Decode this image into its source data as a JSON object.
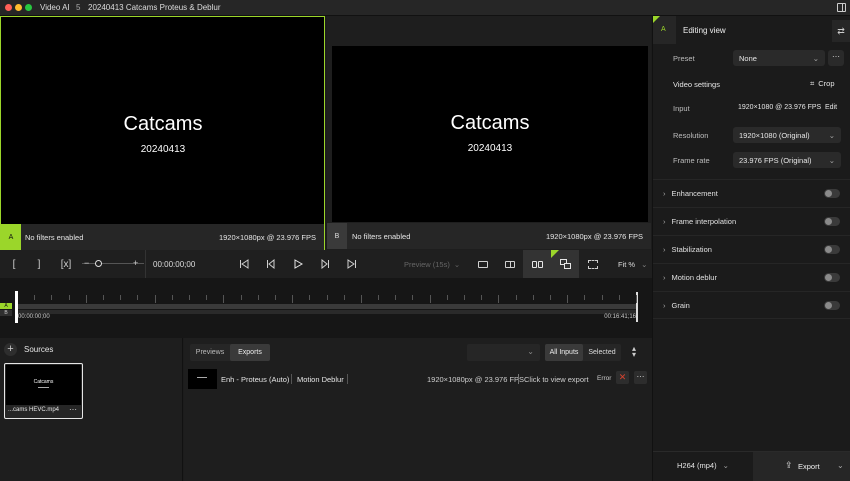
{
  "titlebar": {
    "app_name": "Video AI",
    "app_badge": "5",
    "project_title": "20240413  Catcams Proteus & Deblur"
  },
  "viewers": {
    "a": {
      "badge": "A",
      "title": "Catcams",
      "date": "20240413",
      "filters": "No filters enabled",
      "format": "1920×1080px @ 23.976 FPS"
    },
    "b": {
      "badge": "B",
      "title": "Catcams",
      "date": "20240413",
      "filters": "No filters enabled",
      "format": "1920×1080px @ 23.976 FPS"
    }
  },
  "transport": {
    "timecode": "00:00:00;00",
    "preview_label": "Preview (15s)",
    "zoom_label": "Fit %"
  },
  "timeline": {
    "start_time": "00:00:00;00",
    "end_time": "00:16:41;16",
    "track_a": "A",
    "track_b": "B"
  },
  "sources": {
    "title": "Sources",
    "items": [
      {
        "thumb_title": "Catcams",
        "filename": "...cams HEVC.mp4"
      }
    ]
  },
  "exports": {
    "tabs": [
      {
        "label": "Previews",
        "active": false
      },
      {
        "label": "Exports",
        "active": true
      }
    ],
    "filter_tabs": [
      {
        "label": "All Inputs",
        "active": true
      },
      {
        "label": "Selected",
        "active": false
      }
    ],
    "rows": [
      {
        "model": "Enh - Proteus (Auto)",
        "model2": "Motion Deblur",
        "format": "1920×1080px @ 23.976 FPS",
        "action": "Click to view export",
        "status": "Error"
      }
    ]
  },
  "right_panel": {
    "badge": "A",
    "title": "Editing view",
    "preset_label": "Preset",
    "preset_value": "None",
    "video_settings_label": "Video settings",
    "crop_label": "Crop",
    "input_label": "Input",
    "input_value": "1920×1080 @ 23.976 FPS",
    "edit_label": "Edit",
    "resolution_label": "Resolution",
    "resolution_value": "1920×1080 (Original)",
    "framerate_label": "Frame rate",
    "framerate_value": "23.976 FPS (Original)",
    "sections": [
      "Enhancement",
      "Frame interpolation",
      "Stabilization",
      "Motion deblur",
      "Grain"
    ],
    "codec_value": "H264 (mp4)",
    "export_label": "Export"
  },
  "colors": {
    "accent": "#9bd62a",
    "error": "#d9432f"
  }
}
